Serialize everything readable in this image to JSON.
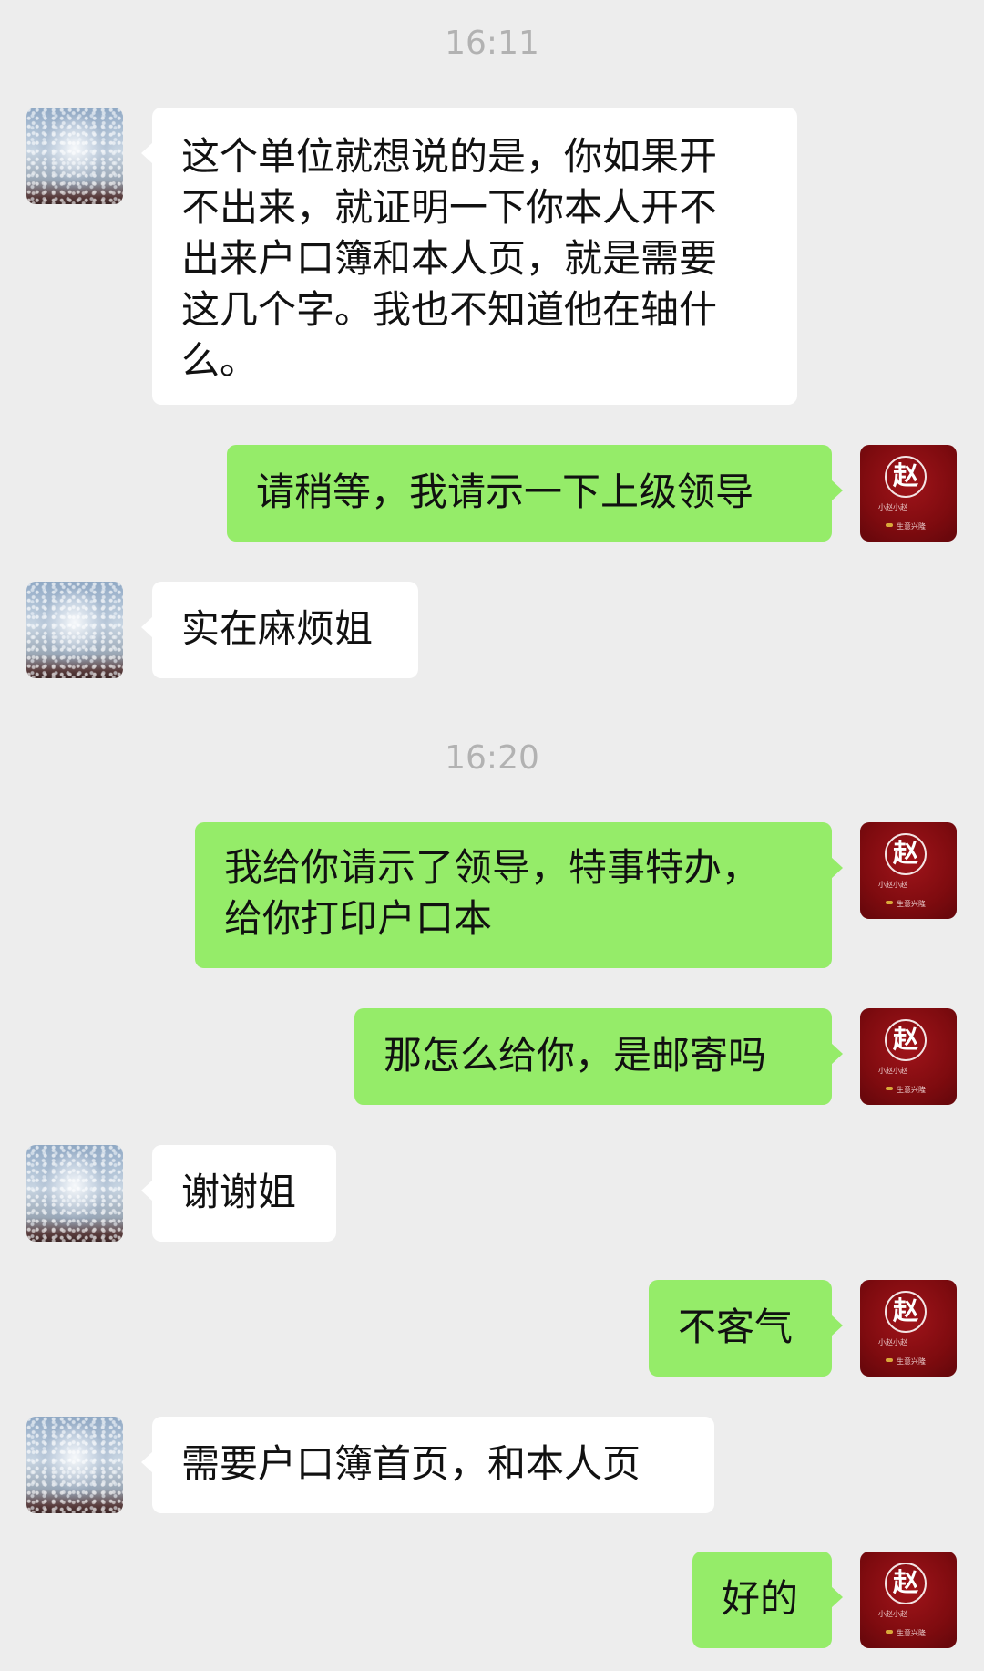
{
  "timestamps": [
    "16:11",
    "16:20"
  ],
  "avatars": {
    "left": {
      "description": "blurred-photo-avatar"
    },
    "right": {
      "seal_character": "赵",
      "small_text_1": "小赵小赵",
      "small_text_2": "生意兴隆"
    }
  },
  "messages": [
    {
      "side": "left",
      "text": "这个单位就想说的是，你如果开\n不出来，就证明一下你本人开不\n出来户口簿和本人页，就是需要\n这几个字。我也不知道他在轴什\n么。"
    },
    {
      "side": "right",
      "text": "请稍等，我请示一下上级领导"
    },
    {
      "side": "left",
      "text": "实在麻烦姐"
    },
    {
      "side": "right",
      "text": "我给你请示了领导，特事特办，\n给你打印户口本"
    },
    {
      "side": "right",
      "text": "那怎么给你，是邮寄吗"
    },
    {
      "side": "left",
      "text": "谢谢姐"
    },
    {
      "side": "right",
      "text": "不客气"
    },
    {
      "side": "left",
      "text": "需要户口簿首页，和本人页"
    },
    {
      "side": "right",
      "text": "好的"
    }
  ],
  "colors": {
    "background": "#ededed",
    "bubble_left": "#ffffff",
    "bubble_right": "#95ec69",
    "timestamp": "#b2b2b2",
    "seal_red": "#7e0b0f"
  }
}
